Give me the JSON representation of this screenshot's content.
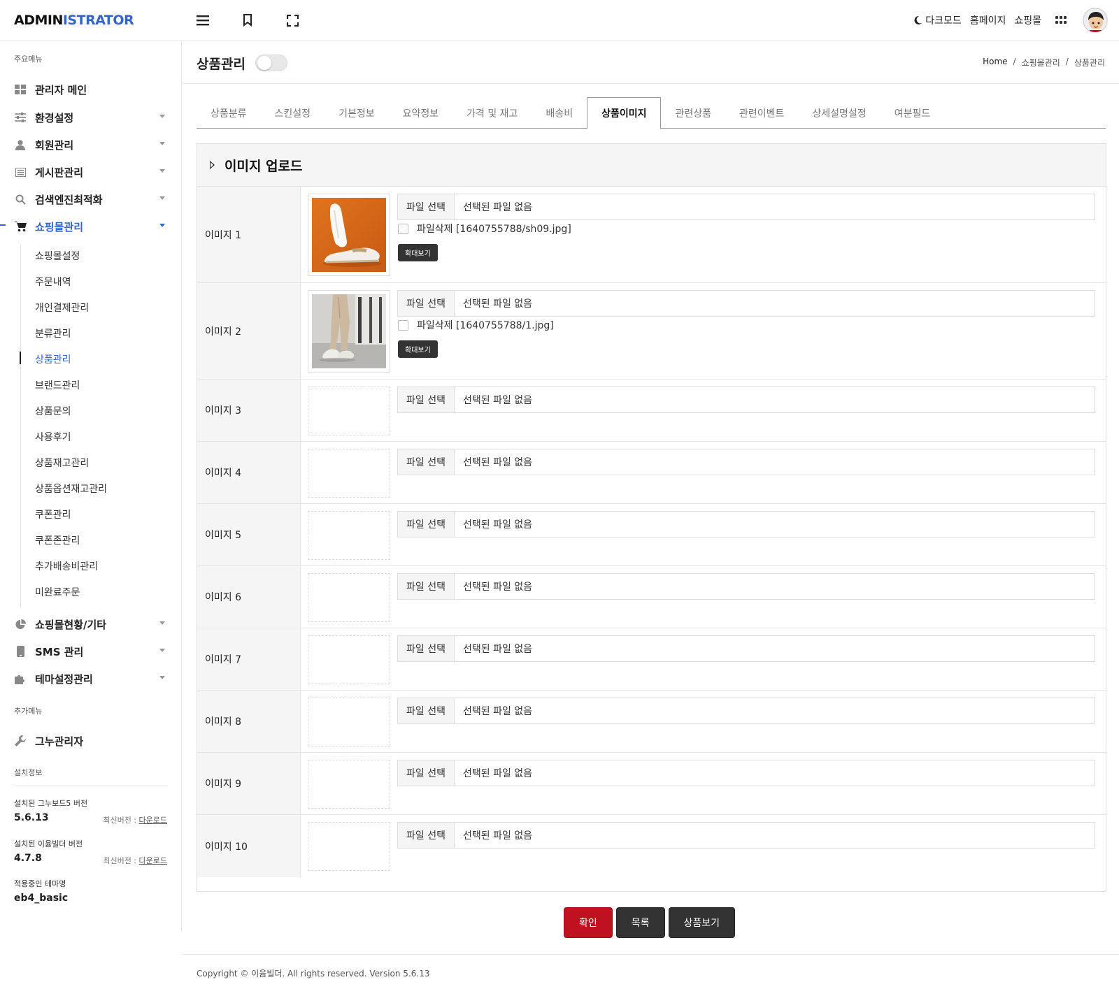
{
  "header": {
    "logo_a": "ADMIN",
    "logo_b": "ISTRATOR",
    "dark_mode": "다크모드",
    "homepage": "홈페이지",
    "shop": "쇼핑몰"
  },
  "sidebar": {
    "main_label": "주요메뉴",
    "items": [
      {
        "label": "관리자 메인",
        "icon": "dashboard-icon"
      },
      {
        "label": "환경설정",
        "icon": "sliders-icon"
      },
      {
        "label": "회원관리",
        "icon": "user-icon"
      },
      {
        "label": "게시판관리",
        "icon": "list-icon"
      },
      {
        "label": "검색엔진최적화",
        "icon": "search-icon"
      },
      {
        "label": "쇼핑몰관리",
        "icon": "cart-icon"
      }
    ],
    "sub_items": [
      "쇼핑몰설정",
      "주문내역",
      "개인결제관리",
      "분류관리",
      "상품관리",
      "브랜드관리",
      "상품문의",
      "사용후기",
      "상품재고관리",
      "상품옵션재고관리",
      "쿠폰관리",
      "쿠폰존관리",
      "추가배송비관리",
      "미완료주문"
    ],
    "more_items": [
      {
        "label": "쇼핑몰현황/기타",
        "icon": "pie-chart-icon"
      },
      {
        "label": "SMS 관리",
        "icon": "phone-icon"
      },
      {
        "label": "테마설정관리",
        "icon": "puzzle-icon"
      }
    ],
    "extra_label": "추가메뉴",
    "extra_item": "그누관리자",
    "install_label": "설치정보",
    "gnuboard_label": "설치된 그누보드5 버전",
    "gnuboard_version": "5.6.13",
    "builder_label": "설치된 이윰빌더 버전",
    "builder_version": "4.7.8",
    "latest_label": "최신버전 :",
    "download": "다운로드",
    "theme_label": "적용중인 테마명",
    "theme_name": "eb4_basic"
  },
  "page": {
    "title": "상품관리",
    "breadcrumb": [
      "Home",
      "쇼핑몰관리",
      "상품관리"
    ]
  },
  "tabs": [
    "상품분류",
    "스킨설정",
    "기본정보",
    "요약정보",
    "가격 및 재고",
    "배송비",
    "상품이미지",
    "관련상품",
    "관련이벤트",
    "상세설명설정",
    "여분필드"
  ],
  "active_tab": "상품이미지",
  "panel": {
    "title": "이미지 업로드",
    "file_button": "파일 선택",
    "no_file": "선택된 파일 없음",
    "zoom_button": "확대보기",
    "rows": [
      {
        "label": "이미지 1",
        "delete_text": "파일삭제 [1640755788/sh09.jpg]"
      },
      {
        "label": "이미지 2",
        "delete_text": "파일삭제 [1640755788/1.jpg]"
      },
      {
        "label": "이미지 3"
      },
      {
        "label": "이미지 4"
      },
      {
        "label": "이미지 5"
      },
      {
        "label": "이미지 6"
      },
      {
        "label": "이미지 7"
      },
      {
        "label": "이미지 8"
      },
      {
        "label": "이미지 9"
      },
      {
        "label": "이미지 10"
      }
    ]
  },
  "actions": {
    "confirm": "확인",
    "list": "목록",
    "view": "상품보기"
  },
  "footer": "Copyright © 이윰빌더. All rights reserved. Version 5.6.13",
  "colors": {
    "accent": "#3465c8",
    "confirm": "#c0111f",
    "dark_button": "#333333"
  }
}
